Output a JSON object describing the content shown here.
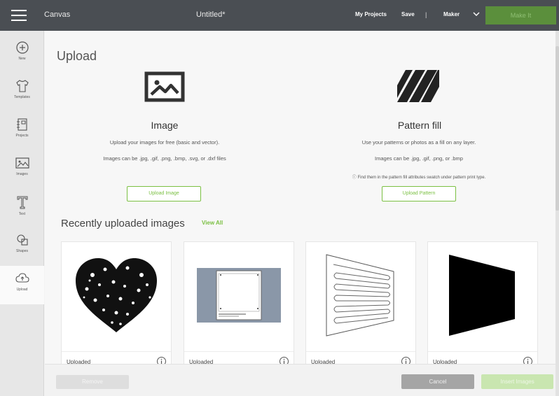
{
  "topbar": {
    "app_name": "Canvas",
    "document_title": "Untitled*",
    "my_projects": "My Projects",
    "save": "Save",
    "separator": "|",
    "machine": "Maker",
    "make_it": "Make It"
  },
  "sidebar": {
    "items": [
      {
        "label": "New",
        "icon": "plus-circle-icon"
      },
      {
        "label": "Templates",
        "icon": "shirt-icon"
      },
      {
        "label": "Projects",
        "icon": "notebook-icon"
      },
      {
        "label": "Images",
        "icon": "image-icon"
      },
      {
        "label": "Text",
        "icon": "text-icon"
      },
      {
        "label": "Shapes",
        "icon": "shapes-icon"
      },
      {
        "label": "Upload",
        "icon": "upload-cloud-icon"
      }
    ],
    "active": "Upload"
  },
  "upload": {
    "title": "Upload",
    "image": {
      "title": "Image",
      "line1": "Upload your images for free (basic and vector).",
      "line2": "Images can be .jpg, .gif, .png, .bmp, .svg, or .dxf files",
      "button": "Upload Image"
    },
    "pattern": {
      "title": "Pattern fill",
      "line1": "Use your patterns or photos as a fill on any layer.",
      "line2": "Images can be .jpg, .gif, .png, or .bmp",
      "note": "ⓘ Find them in the pattern fill attributes swatch under pattern print type.",
      "button": "Upload Pattern"
    }
  },
  "recent": {
    "title": "Recently uploaded images",
    "view_all": "View All",
    "cards": [
      {
        "status": "Uploaded",
        "icon": "heart-collage-thumbnail"
      },
      {
        "status": "Uploaded",
        "icon": "screenshot-thumbnail"
      },
      {
        "status": "Uploaded",
        "icon": "serpentine-lines-thumbnail"
      },
      {
        "status": "Uploaded",
        "icon": "black-trapezoid-thumbnail"
      }
    ]
  },
  "footer": {
    "remove": "Remove",
    "cancel": "Cancel",
    "insert": "Insert Images"
  },
  "colors": {
    "accent_green": "#7bc043",
    "topbar_bg": "#4a4e53",
    "make_it_bg": "#5b8f3c"
  }
}
